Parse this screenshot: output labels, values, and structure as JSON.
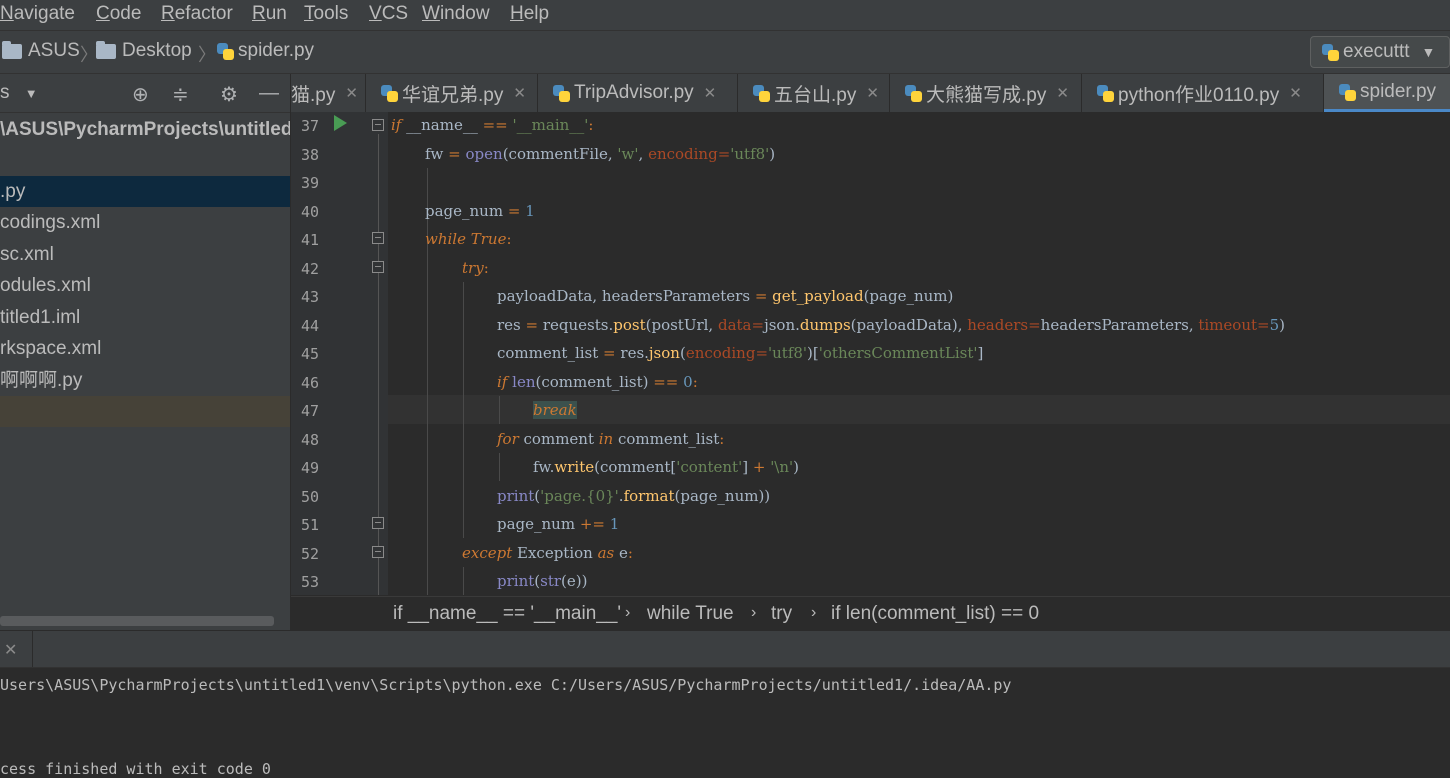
{
  "menu": [
    "Navigate",
    "Code",
    "Refactor",
    "Run",
    "Tools",
    "VCS",
    "Window",
    "Help"
  ],
  "navbar": {
    "crumbs": [
      "ASUS",
      "Desktop",
      "spider.py"
    ],
    "run_config": "executtt"
  },
  "project_panel": {
    "header_label": "s",
    "root": "\\ASUS\\PycharmProjects\\untitled",
    "items": [
      ".py",
      "codings.xml",
      "sc.xml",
      "odules.xml",
      "titled1.iml",
      "rkspace.xml",
      "啊啊啊.py",
      ""
    ]
  },
  "tabs": [
    "猫.py",
    "华谊兄弟.py",
    "TripAdvisor.py",
    "五台山.py",
    "大熊猫写成.py",
    "python作业0110.py",
    "spider.py"
  ],
  "active_tab": "spider.py",
  "editor": {
    "line_numbers": [
      "37",
      "38",
      "39",
      "40",
      "41",
      "42",
      "43",
      "44",
      "45",
      "46",
      "47",
      "48",
      "49",
      "50",
      "51",
      "52",
      "53"
    ]
  },
  "breadcrumb": [
    "if __name__ == '__main__'",
    "while True",
    "try",
    "if len(comment_list) == 0"
  ],
  "run_output": {
    "command": "Users\\ASUS\\PycharmProjects\\untitled1\\venv\\Scripts\\python.exe C:/Users/ASUS/PycharmProjects/untitled1/.idea/AA.py",
    "finished": "cess finished with exit code 0"
  },
  "colors": {
    "background": "#2b2b2b",
    "panel": "#3c3f41",
    "keyword": "#cc7832",
    "string": "#6a8759",
    "number": "#6897bb",
    "selection": "#0d293e",
    "tab_underline": "#4a88c7"
  },
  "icons": [
    "folder-icon",
    "python-file-icon",
    "target-icon",
    "collapse-icon",
    "gear-icon",
    "minimize-icon",
    "close-icon",
    "run-arrow-icon",
    "dropdown-icon"
  ]
}
